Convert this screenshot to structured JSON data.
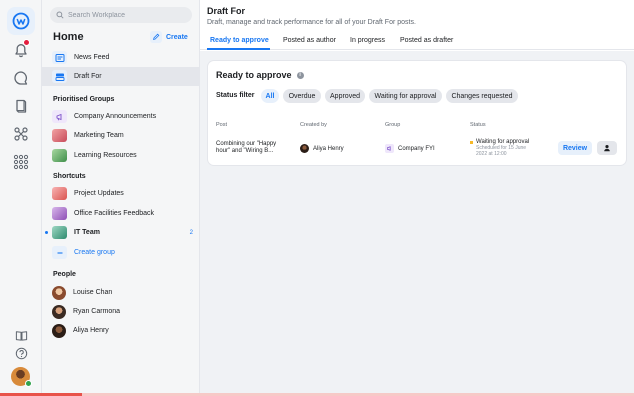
{
  "colors": {
    "accent": "#1877f2",
    "notification": "#e41e3f",
    "pending": "#f7b928"
  },
  "rail": {
    "icons": [
      "workplace-logo-icon",
      "notifications-icon",
      "chat-icon",
      "knowledge-library-icon",
      "integrations-icon",
      "apps-grid-icon",
      "knowledge-icon",
      "help-icon"
    ]
  },
  "sidebar": {
    "search_placeholder": "Search Workplace",
    "home_title": "Home",
    "create_label": "Create",
    "main_items": [
      {
        "label": "News Feed",
        "icon": "news-feed-icon"
      },
      {
        "label": "Draft For",
        "icon": "draft-for-icon",
        "selected": true
      }
    ],
    "prioritised_title": "Prioritised Groups",
    "prioritised": [
      {
        "label": "Company Announcements"
      },
      {
        "label": "Marketing Team"
      },
      {
        "label": "Learning Resources"
      }
    ],
    "shortcuts_title": "Shortcuts",
    "shortcuts": [
      {
        "label": "Project Updates"
      },
      {
        "label": "Office Facilities Feedback"
      },
      {
        "label": "IT Team",
        "count": "2",
        "unread": true
      },
      {
        "label": "Create group"
      }
    ],
    "people_title": "People",
    "people": [
      {
        "name": "Louise Chan"
      },
      {
        "name": "Ryan Carmona"
      },
      {
        "name": "Aliya Henry"
      }
    ]
  },
  "main": {
    "title": "Draft For",
    "subtitle": "Draft, manage and track performance for all of your Draft For posts.",
    "tabs": [
      "Ready to approve",
      "Posted as author",
      "In progress",
      "Posted as drafter"
    ],
    "active_tab": "Ready to approve",
    "card": {
      "title": "Ready to approve",
      "filter_label": "Status filter",
      "chips": [
        "All",
        "Overdue",
        "Approved",
        "Waiting for approval",
        "Changes requested"
      ],
      "columns": [
        "Post",
        "Created by",
        "Group",
        "Status"
      ],
      "row": {
        "post": "Combining our \"Happy hour\" and \"Wiring B...",
        "created_by": "Aliya Henry",
        "group": "Company FYI",
        "status": "Waiting for approval",
        "status_time_1": "Scheduled for 15 June",
        "status_time_2": "2022 at 12:00",
        "review_label": "Review"
      }
    }
  }
}
